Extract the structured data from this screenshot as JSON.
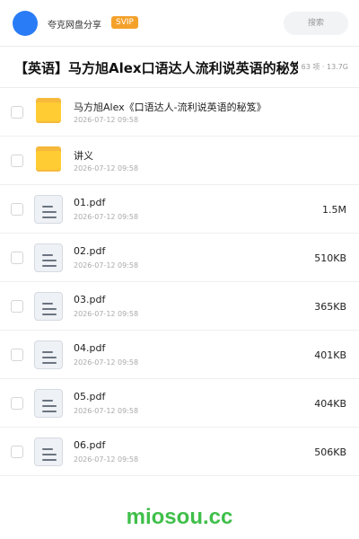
{
  "topbar": {
    "user_name": "夸克网盘分享",
    "badge": "SVIP",
    "search_placeholder": "搜索",
    "avatar_color": "#2a7cf6"
  },
  "header": {
    "title": "【英语】马方旭Alex口语达人流利说英语的秘笈",
    "meta": "63 项 · 13.7G"
  },
  "files": [
    {
      "type": "folder",
      "name": "马方旭Alex《口语达人-流利说英语的秘笈》",
      "date": "2026-07-12 09:58",
      "size": ""
    },
    {
      "type": "folder",
      "name": "讲义",
      "date": "2026-07-12 09:58",
      "size": ""
    },
    {
      "type": "file",
      "name": "01.pdf",
      "date": "2026-07-12 09:58",
      "size": "1.5M"
    },
    {
      "type": "file",
      "name": "02.pdf",
      "date": "2026-07-12 09:58",
      "size": "510KB"
    },
    {
      "type": "file",
      "name": "03.pdf",
      "date": "2026-07-12 09:58",
      "size": "365KB"
    },
    {
      "type": "file",
      "name": "04.pdf",
      "date": "2026-07-12 09:58",
      "size": "401KB"
    },
    {
      "type": "file",
      "name": "05.pdf",
      "date": "2026-07-12 09:58",
      "size": "404KB"
    },
    {
      "type": "file",
      "name": "06.pdf",
      "date": "2026-07-12 09:58",
      "size": "506KB"
    }
  ],
  "watermark": "miosou.cc",
  "colors": {
    "folder": "#ffcc33",
    "badge": "#f4a12a",
    "watermark": "#3fbf4a"
  }
}
